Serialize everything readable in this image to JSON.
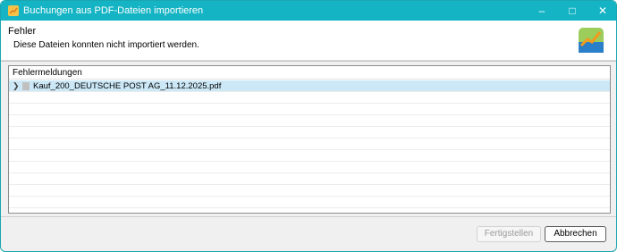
{
  "window": {
    "title": "Buchungen aus PDF-Dateien importieren",
    "icon": "app-icon",
    "controls": {
      "minimize": "–",
      "maximize": "□",
      "close": "✕"
    }
  },
  "header": {
    "title": "Fehler",
    "message": "Diese Dateien konnten nicht importiert werden.",
    "logo": "portfolio-chart-logo"
  },
  "table": {
    "column_header": "Fehlermeldungen",
    "rows": [
      {
        "label": "Kauf_200_DEUTSCHE POST AG_11.12.2025.pdf",
        "expanded": false,
        "selected": true
      }
    ]
  },
  "buttons": {
    "finish_label": "Fertigstellen",
    "cancel_label": "Abbrechen"
  },
  "colors": {
    "titlebar": "#14b4c4",
    "selection": "#cce8f7"
  }
}
